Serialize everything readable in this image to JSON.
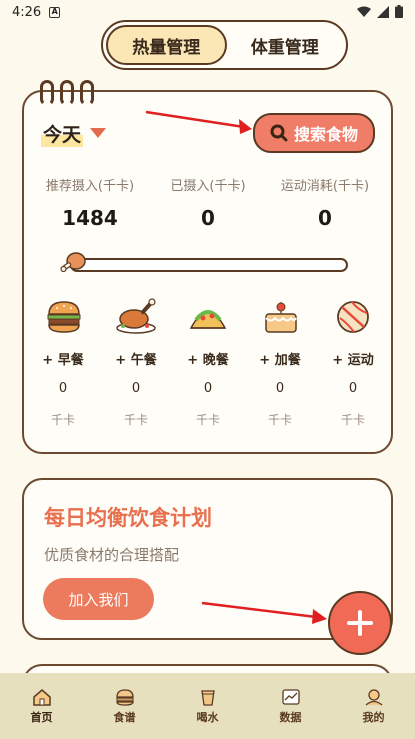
{
  "status": {
    "time": "4:26"
  },
  "tabs": [
    {
      "label": "热量管理",
      "active": true
    },
    {
      "label": "体重管理",
      "active": false
    }
  ],
  "calorie_card": {
    "date": "今天",
    "search_label": "搜索食物",
    "stats": [
      {
        "label": "推荐摄入(千卡)",
        "value": "1484"
      },
      {
        "label": "已摄入(千卡)",
        "value": "0"
      },
      {
        "label": "运动消耗(千卡)",
        "value": "0"
      }
    ],
    "progress": 0,
    "meals": [
      {
        "label": "+ 早餐",
        "value": "0",
        "unit": "千卡",
        "icon": "burger-icon"
      },
      {
        "label": "+ 午餐",
        "value": "0",
        "unit": "千卡",
        "icon": "roast-chicken-icon"
      },
      {
        "label": "+ 晚餐",
        "value": "0",
        "unit": "千卡",
        "icon": "taco-icon"
      },
      {
        "label": "+ 加餐",
        "value": "0",
        "unit": "千卡",
        "icon": "cake-icon"
      },
      {
        "label": "+ 运动",
        "value": "0",
        "unit": "千卡",
        "icon": "ball-icon"
      }
    ]
  },
  "plan_card": {
    "title": "每日均衡饮食计划",
    "subtitle": "优质食材的合理搭配",
    "button": "加入我们"
  },
  "bottom_nav": [
    {
      "label": "首页",
      "icon": "home-icon",
      "active": true
    },
    {
      "label": "食谱",
      "icon": "recipe-icon",
      "active": false
    },
    {
      "label": "喝水",
      "icon": "water-cup-icon",
      "active": false
    },
    {
      "label": "数据",
      "icon": "data-chart-icon",
      "active": false
    },
    {
      "label": "我的",
      "icon": "profile-icon",
      "active": false
    }
  ],
  "colors": {
    "accent": "#f07d68",
    "brown": "#5a3a22",
    "title_orange": "#e8704f",
    "nav_bg": "#e7e0bf",
    "annotation_arrow": "#e02020"
  }
}
